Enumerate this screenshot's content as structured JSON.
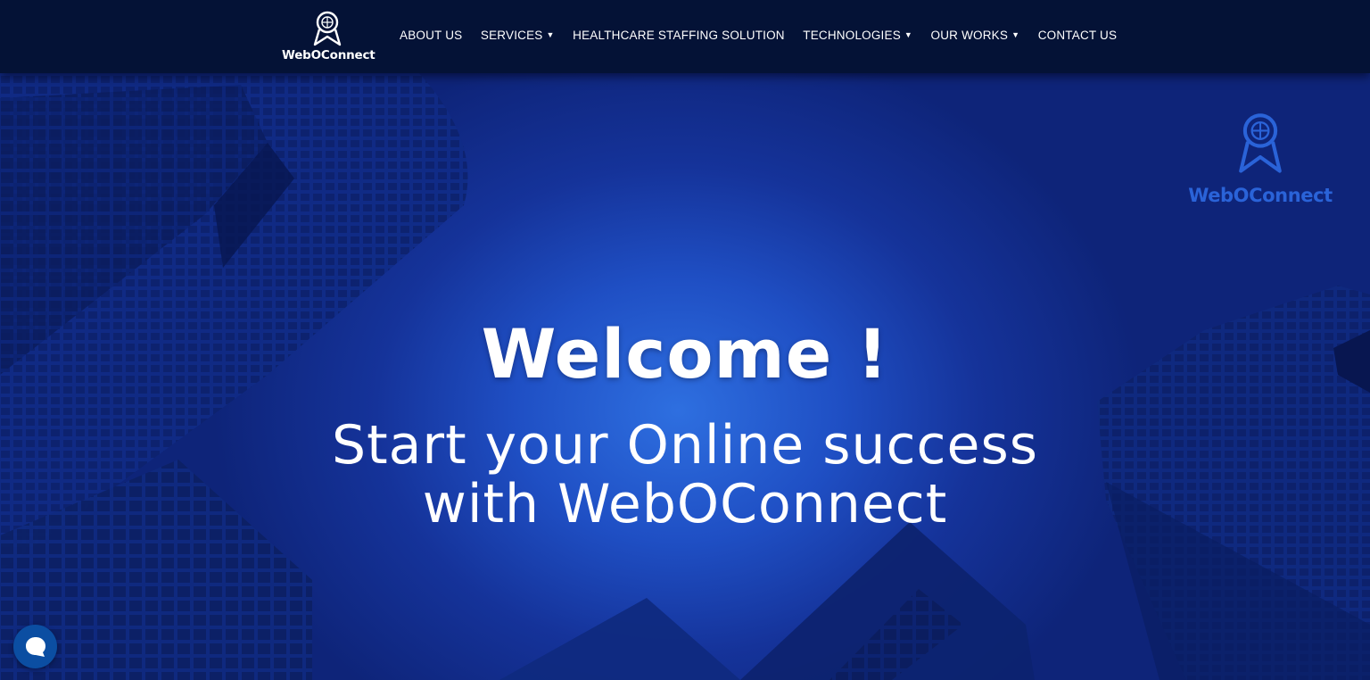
{
  "brand": {
    "name": "WebOConnect"
  },
  "nav": {
    "items": [
      {
        "label": "ABOUT US",
        "dropdown": false
      },
      {
        "label": "SERVICES",
        "dropdown": true
      },
      {
        "label": "HEALTHCARE STAFFING SOLUTION",
        "dropdown": false
      },
      {
        "label": "TECHNOLOGIES",
        "dropdown": true
      },
      {
        "label": "OUR WORKS",
        "dropdown": true
      },
      {
        "label": "CONTACT US",
        "dropdown": false
      }
    ],
    "caret_icon": "chevron-down-icon"
  },
  "hero": {
    "watermark": "WebOConnect",
    "headline": "Welcome !",
    "subline_1": "Start your Online success",
    "subline_2": "with WebOConnect"
  },
  "chat": {
    "icon": "chat-bubble-icon"
  },
  "colors": {
    "nav_bg": "#041236",
    "hero_blue": "#1f4fc4",
    "watermark_blue": "#2a63d8",
    "chat_button": "#0b4ea2",
    "text": "#ffffff"
  }
}
